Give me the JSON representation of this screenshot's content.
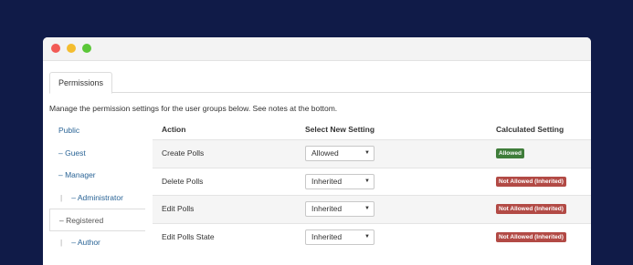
{
  "tab_label": "Permissions",
  "description": "Manage the permission settings for the user groups below. See notes at the bottom.",
  "groups": [
    {
      "label": "Public",
      "pipe": ""
    },
    {
      "label": "– Guest",
      "pipe": ""
    },
    {
      "label": "– Manager",
      "pipe": ""
    },
    {
      "label": "– Administrator",
      "pipe": "|"
    },
    {
      "label": "– Registered",
      "pipe": ""
    },
    {
      "label": "– Author",
      "pipe": "|"
    }
  ],
  "table": {
    "headers": {
      "action": "Action",
      "select": "Select New Setting",
      "calculated": "Calculated Setting"
    },
    "rows": [
      {
        "action": "Create Polls",
        "setting": "Allowed",
        "calculated": "Allowed",
        "status": "allowed"
      },
      {
        "action": "Delete Polls",
        "setting": "Inherited",
        "calculated": "Not Allowed (Inherited)",
        "status": "denied"
      },
      {
        "action": "Edit Polls",
        "setting": "Inherited",
        "calculated": "Not Allowed (Inherited)",
        "status": "denied"
      },
      {
        "action": "Edit Polls State",
        "setting": "Inherited",
        "calculated": "Not Allowed (Inherited)",
        "status": "denied"
      }
    ]
  },
  "colors": {
    "allowed": "#3f7d3a",
    "denied": "#b24a45",
    "background": "#101b48"
  }
}
